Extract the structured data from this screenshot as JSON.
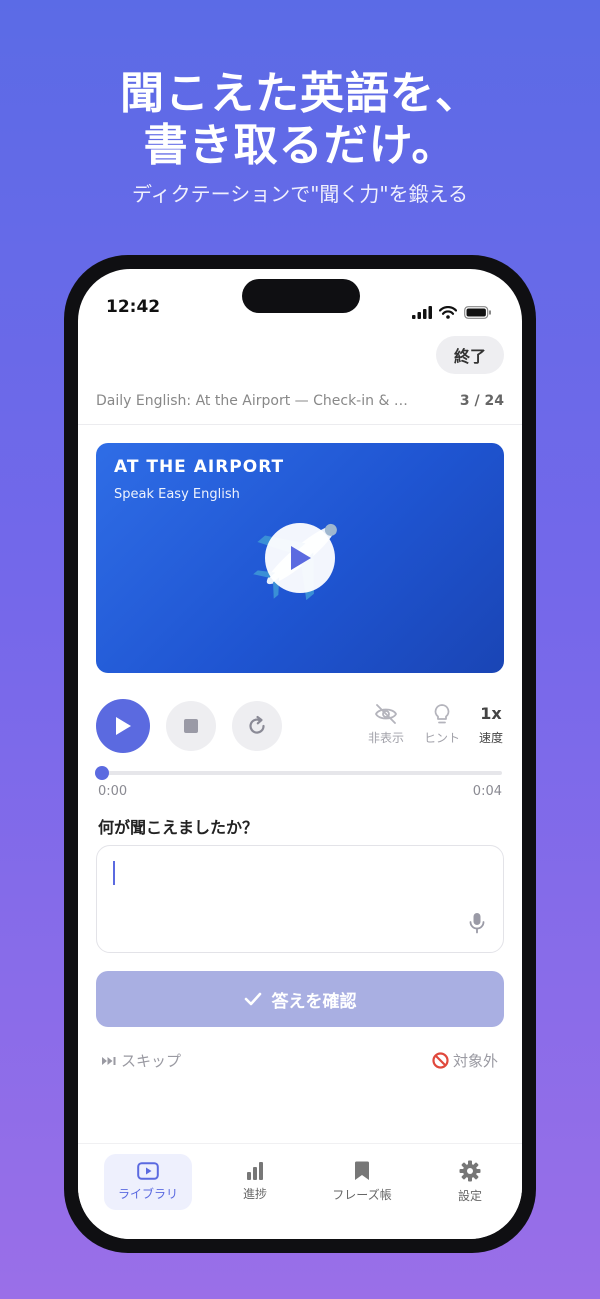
{
  "promo": {
    "headline_line1": "聞こえた英語を、",
    "headline_line2": "書き取るだけ。",
    "subheadline": "ディクテーションで\"聞く力\"を鍛える"
  },
  "status_bar": {
    "time": "12:42"
  },
  "header": {
    "end_button": "終了",
    "lesson_title": "Daily English: At the Airport — Check-in & Bo…",
    "lesson_progress": "3 / 24"
  },
  "video": {
    "title": "AT THE AIRPORT",
    "subtitle": "Speak Easy English"
  },
  "controls": {
    "hide_label": "非表示",
    "hint_label": "ヒント",
    "speed_value": "1x",
    "speed_label": "速度"
  },
  "playback": {
    "current_time": "0:00",
    "duration": "0:04",
    "progress": 0
  },
  "question": "何が聞こえましたか？",
  "answer": {
    "value": ""
  },
  "confirm_button": "答えを確認",
  "skip_label": "スキップ",
  "exclude_label": "対象外",
  "tabs": [
    {
      "label": "ライブラリ",
      "icon": "play-square-icon",
      "active": true
    },
    {
      "label": "進捗",
      "icon": "bar-chart-icon",
      "active": false
    },
    {
      "label": "フレーズ帳",
      "icon": "bookmark-icon",
      "active": false
    },
    {
      "label": "設定",
      "icon": "gear-icon",
      "active": false
    }
  ],
  "colors": {
    "accent": "#5b6ae0",
    "confirm_disabled": "#a9afe2",
    "background_top": "#5b6be6",
    "background_bottom": "#9a6fe8"
  }
}
